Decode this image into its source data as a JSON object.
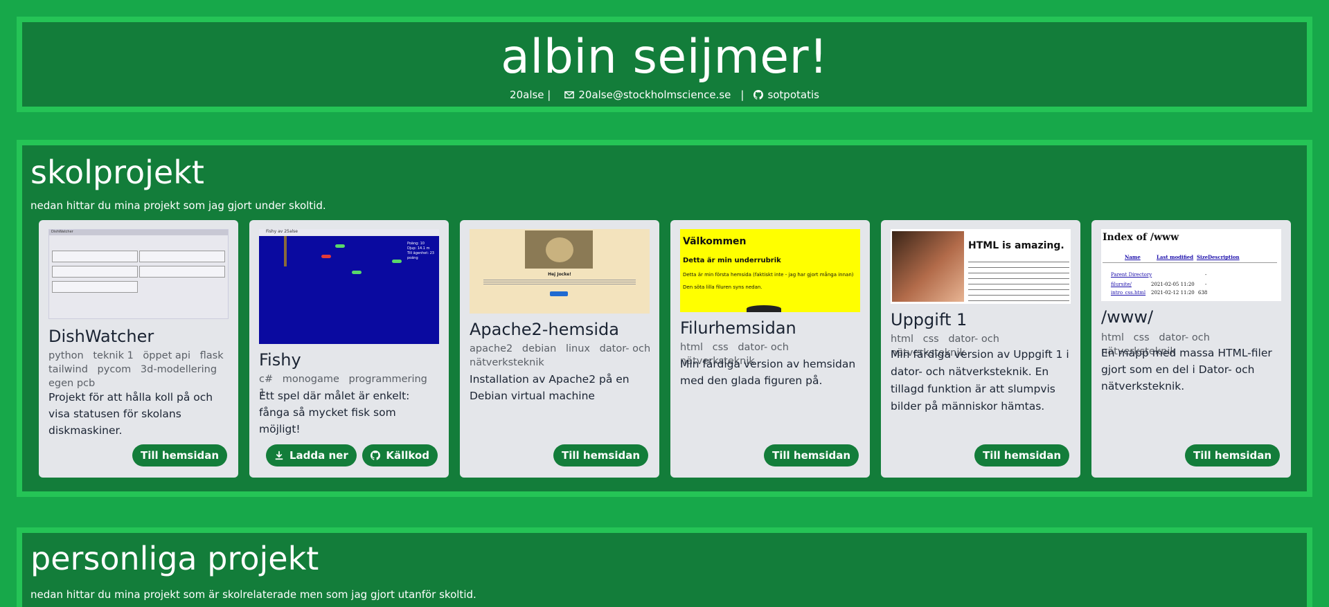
{
  "header": {
    "title": "albin seijmer!",
    "username": "20alse |",
    "email": "20alse@stockholmscience.se",
    "separator": "|",
    "github": "sotpotatis"
  },
  "school": {
    "title": "skolprojekt",
    "description": "nedan hittar du mina projekt som jag gjort under skoltid.",
    "cards": [
      {
        "title": "DishWatcher",
        "tags": [
          "python",
          "teknik 1",
          "öppet api",
          "flask",
          "tailwind",
          "pycom",
          "3d-modellering",
          "egen pcb"
        ],
        "description": "Projekt för att hålla koll på och visa statusen för skolans diskmaskiner.",
        "button": "Till hemsidan"
      },
      {
        "title": "Fishy",
        "tags": [
          "c#",
          "monogame",
          "programmering 1"
        ],
        "description": "Ett spel där målet är enkelt: fånga så mycket fisk som möjligt!",
        "button_download": "Ladda ner",
        "button_source": "Källkod"
      },
      {
        "title": "Apache2-hemsida",
        "tags": [
          "apache2",
          "debian",
          "linux",
          "dator- och nätverksteknik"
        ],
        "description": "Installation av Apache2 på en Debian virtual machine",
        "button": "Till hemsidan"
      },
      {
        "title": "Filurhemsidan",
        "tags": [
          "html",
          "css",
          "dator- och nätverksteknik"
        ],
        "description": "Min färdiga version av hemsidan med den glada figuren på.",
        "button": "Till hemsidan"
      },
      {
        "title": "Uppgift 1",
        "tags": [
          "html",
          "css",
          "dator- och nätverksteknik"
        ],
        "description": "Min färdiga version av Uppgift 1 i dator- och nätverksteknik. En tillagd funktion är att slumpvis bilder på människor hämtas.",
        "button": "Till hemsidan"
      },
      {
        "title": "/www/",
        "tags": [
          "html",
          "css",
          "dator- och nätverksteknik"
        ],
        "description": "En mapp med massa HTML-filer gjort som en del i Dator- och nätverksteknik.",
        "button": "Till hemsidan"
      }
    ]
  },
  "thumbs": {
    "dishwatcher_app": "DishWatcher",
    "fishy_window": "Fishy av 25alse",
    "fishy_hud": [
      "Poäng: 10",
      "Djup: 14.1 m",
      "Till ägenhet: 23 poäng"
    ],
    "apache_heading": "Hej Jocke!",
    "filur_heading": "Välkommen",
    "filur_subheading": "Detta är min underrubrik",
    "filur_text1": "Detta är min första hemsida (faktiskt inte - jag har gjort många innan)",
    "filur_text2": "Den söta lilla filuren syns nedan.",
    "uppgift_heading": "HTML is amazing.",
    "index_heading": "Index of /www",
    "index_cols": [
      "Name",
      "Last modified",
      "Size",
      "Description"
    ],
    "index_rows": [
      [
        "Parent Directory",
        "",
        "-",
        ""
      ],
      [
        "filursite/",
        "2021-02-05 11:20",
        "-",
        ""
      ],
      [
        "intro_css.html",
        "2021-02-12 11:20",
        "638",
        ""
      ]
    ]
  },
  "personal": {
    "title": "personliga projekt",
    "description": "nedan hittar du mina projekt som är skolrelaterade men som jag gjort utanför skoltid."
  },
  "colors": {
    "background": "#17a84a",
    "panel": "#137d3a",
    "panel_border": "#25c456",
    "card": "#e4e6ea",
    "button": "#137d3a"
  },
  "icons": [
    "mail-icon",
    "github-icon",
    "download-icon"
  ]
}
